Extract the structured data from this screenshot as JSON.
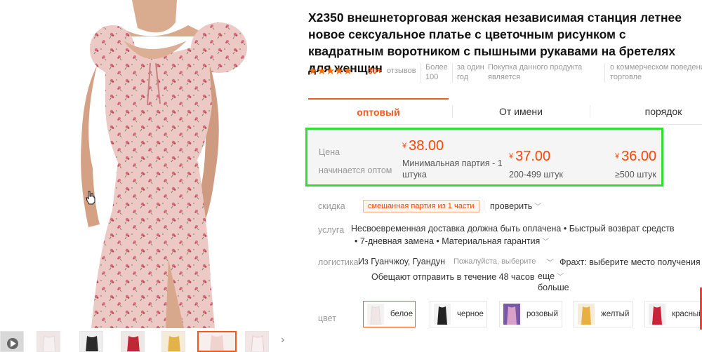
{
  "product": {
    "title": "X2350 внешнеторговая женская независимая станция летнее новое сексуальное платье с цветочным рисунком с квадратным воротником с пышными рукавами на бретелях для женщин",
    "rating_stars": "★★★★★",
    "review_count": "30+",
    "review_label": "отзывов",
    "meta": {
      "sold_line1": "Более",
      "sold_line2": "100",
      "period_line1": "за один",
      "period_line2": "год",
      "purchase_line1": "Покупка данного продукта",
      "purchase_line2": "является",
      "commercial_line1": "о коммерческом поведени",
      "commercial_line2": "торговле"
    }
  },
  "tabs": [
    {
      "label": "оптовый",
      "active": true
    },
    {
      "label": "От имени",
      "active": false
    },
    {
      "label": "порядок",
      "active": false
    }
  ],
  "price_box": {
    "label_line1": "Цена",
    "label_line2": "начинается оптом",
    "currency": "¥",
    "tiers": [
      {
        "price": "38.00",
        "note_line1": "Минимальная партия - 1",
        "note_line2": "штука"
      },
      {
        "price": "37.00",
        "note_line1": "200-499 штук",
        "note_line2": ""
      },
      {
        "price": "36.00",
        "note_line1": "≥500 штук",
        "note_line2": ""
      }
    ],
    "highlight_color": "#33dd33"
  },
  "discount": {
    "label": "скидка",
    "badge": "смешанная партия из 1 части",
    "check_label": "проверить"
  },
  "service": {
    "label": "услуга",
    "line1": "Несвоевременная доставка должна быть оплачена • Быстрый возврат средств",
    "line2": "• 7-дневная замена • Материальная гарантия"
  },
  "logistics": {
    "label": "логистика",
    "origin": "Из Гуанчжоу, Гуандун",
    "choose_hint": "Пожалуйста, выберите",
    "freight": "Фрахт: выберите место получения",
    "promise": "Обещают отправить в течение 48 часов",
    "more_line1": "еще",
    "more_line2": "больше"
  },
  "colors": {
    "label": "цвет",
    "options": [
      {
        "name": "белое",
        "selected": true,
        "swatch": "#f2e4e4"
      },
      {
        "name": "черное",
        "selected": false,
        "swatch": "#222222"
      },
      {
        "name": "розовый",
        "selected": false,
        "swatch": "#d9a0c8"
      },
      {
        "name": "желтый",
        "selected": false,
        "swatch": "#e8b040"
      },
      {
        "name": "красный",
        "selected": false,
        "swatch": "#c8243a"
      }
    ]
  },
  "thumbnails": [
    {
      "swatch": "#d8d8d8",
      "icon": "play-icon"
    },
    {
      "swatch": "#f1e6e6"
    },
    {
      "swatch": "#2a2a2a"
    },
    {
      "swatch": "#c02838"
    },
    {
      "swatch": "#e3b34a"
    },
    {
      "swatch": "#f0d2cf",
      "active": true
    },
    {
      "swatch": "#f4e6e6"
    }
  ],
  "accent_color": "#f05a1a",
  "price_color": "#ff4400"
}
